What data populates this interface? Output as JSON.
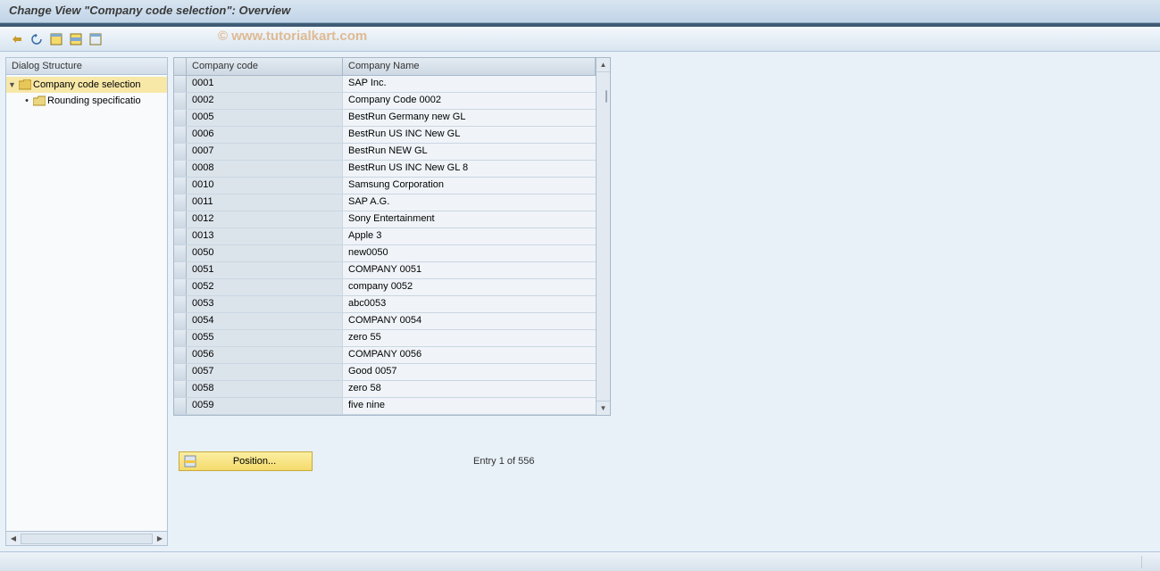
{
  "title": "Change View \"Company code selection\": Overview",
  "watermark": "© www.tutorialkart.com",
  "toolbar_icons": [
    "toggle-icon",
    "undo-icon",
    "select-all-icon",
    "select-block-icon",
    "deselect-icon"
  ],
  "tree": {
    "header": "Dialog Structure",
    "root": {
      "label": "Company code selection",
      "selected": true,
      "child": {
        "label": "Rounding specificatio"
      }
    }
  },
  "table": {
    "headers": {
      "code": "Company code",
      "name": "Company Name"
    },
    "rows": [
      {
        "code": "0001",
        "name": "SAP Inc."
      },
      {
        "code": "0002",
        "name": "Company Code 0002"
      },
      {
        "code": "0005",
        "name": "BestRun Germany new GL"
      },
      {
        "code": "0006",
        "name": "BestRun US INC New GL"
      },
      {
        "code": "0007",
        "name": "BestRun NEW GL"
      },
      {
        "code": "0008",
        "name": "BestRun US INC New GL 8"
      },
      {
        "code": "0010",
        "name": "Samsung Corporation"
      },
      {
        "code": "0011",
        "name": "SAP A.G."
      },
      {
        "code": "0012",
        "name": "Sony Entertainment"
      },
      {
        "code": "0013",
        "name": "Apple 3"
      },
      {
        "code": "0050",
        "name": "new0050"
      },
      {
        "code": "0051",
        "name": "COMPANY 0051"
      },
      {
        "code": "0052",
        "name": "company 0052"
      },
      {
        "code": "0053",
        "name": "abc0053"
      },
      {
        "code": "0054",
        "name": "COMPANY 0054"
      },
      {
        "code": "0055",
        "name": "zero 55"
      },
      {
        "code": "0056",
        "name": "COMPANY 0056"
      },
      {
        "code": "0057",
        "name": "Good 0057"
      },
      {
        "code": "0058",
        "name": "zero 58"
      },
      {
        "code": "0059",
        "name": "five nine"
      }
    ]
  },
  "position_button": "Position...",
  "entry_status": "Entry 1 of 556",
  "statusbar": {
    "right": ""
  }
}
